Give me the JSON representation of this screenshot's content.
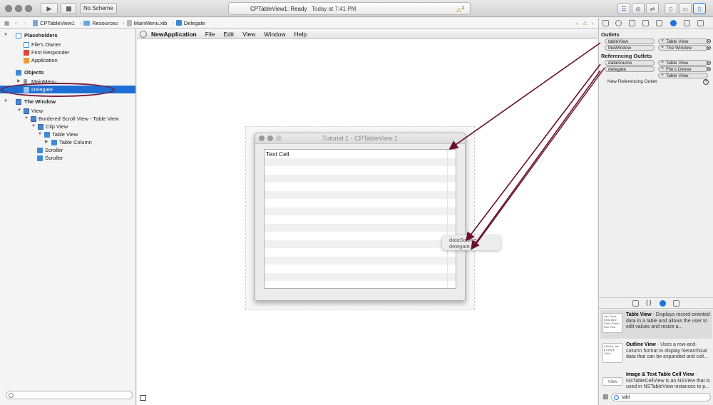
{
  "toolbar": {
    "scheme": "No Scheme",
    "project_status": "CPTableView1: Ready",
    "timestamp": "Today at 7:41 PM",
    "warning_count": "2"
  },
  "jumpbar": {
    "crumbs": [
      "CPTableView1",
      "Resources",
      "MainMenu.xib",
      "Delegate"
    ]
  },
  "outline": {
    "placeholders_header": "Placeholders",
    "placeholders": [
      "File's Owner",
      "First Responder",
      "Application"
    ],
    "objects_header": "Objects",
    "objects": [
      "MainMenu",
      "Delegate"
    ],
    "window_header": "The Window",
    "tree": [
      "View",
      "Bordered Scroll View - Table View",
      "Clip View",
      "Table View",
      "Table Column",
      "Scroller",
      "Scroller"
    ]
  },
  "menubar": {
    "app_name": "NewApplication",
    "items": [
      "File",
      "Edit",
      "View",
      "Window",
      "Help"
    ]
  },
  "window": {
    "title": "Tutorial 1 - CPTableView 1",
    "cell_text": "Text Cell"
  },
  "popup": {
    "items": [
      "dataSource",
      "delegate"
    ]
  },
  "inspector": {
    "outlets_title": "Outlets",
    "outlets": [
      {
        "name": "tableView",
        "target": "Table View"
      },
      {
        "name": "theWindow",
        "target": "The Window"
      }
    ],
    "referencing_title": "Referencing Outlets",
    "referencing": [
      {
        "name": "dataSource",
        "target": "Table View"
      },
      {
        "name": "delegate",
        "targets": [
          "File's Owner",
          "Table View"
        ]
      }
    ],
    "new_referencing": "New Referencing Outlet"
  },
  "library": {
    "items": [
      {
        "title": "Table View",
        "desc": " - Displays record-oriented data in a table and allows the user to edit values and resize a...",
        "thumb": "Jan Clear Kelly Blue Chris Green Ron Pink"
      },
      {
        "title": "Outline View",
        "desc": " - Uses a row-and-column format to display hierarchical data that can be expanded and coll...",
        "thumb": "▾ Mail ▸ Jan ▸ Kelly ▸ Chris"
      },
      {
        "title": "Image & Text Table Cell View",
        "desc": " - NSTableCellView is an NSView that is used in NSTableView instances to p...",
        "thumb": "View"
      }
    ],
    "search_value": "tabl"
  },
  "colors": {
    "selection": "#1d6fd5",
    "annotation": "#7a1b38"
  }
}
